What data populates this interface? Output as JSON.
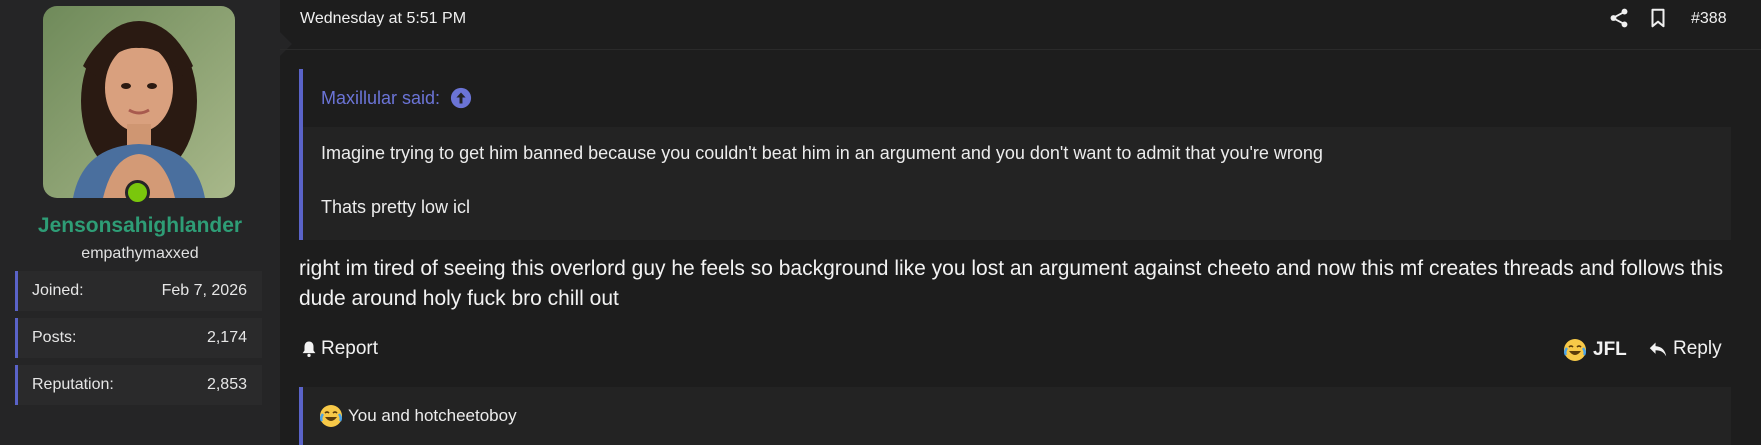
{
  "user": {
    "username": "Jensonsahighlander",
    "title": "empathymaxxed",
    "stats": [
      {
        "label": "Joined:",
        "value": "Feb 7, 2026"
      },
      {
        "label": "Posts:",
        "value": "2,174"
      },
      {
        "label": "Reputation:",
        "value": "2,853"
      }
    ],
    "online": true
  },
  "post": {
    "date": "Wednesday at 5:51 PM",
    "number": "#388",
    "quote": {
      "author": "Maxillular said:",
      "lines": [
        "Imagine trying to get him banned because you couldn't beat him in an argument and you don't want to admit that you're wrong",
        "Thats pretty low icl"
      ]
    },
    "body": "right im tired of seeing this overlord guy he feels so background like you lost an argument against cheeto and now this mf creates threads and follows this dude around holy fuck bro chill out",
    "actions": {
      "report": "Report",
      "reaction": "JFL",
      "reply": "Reply"
    },
    "reactions_summary": "You and hotcheetoboy"
  },
  "colors": {
    "accent": "#5a63c8",
    "username": "#2e9d76",
    "online": "#7ac70c",
    "background": "#1d1d1d"
  },
  "icons": [
    "share-icon",
    "bookmark-icon",
    "arrow-up-icon",
    "bell-icon",
    "reply-icon",
    "laughing-crying-emoji-icon"
  ]
}
